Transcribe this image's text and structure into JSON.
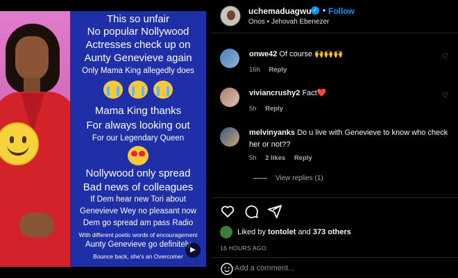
{
  "media": {
    "lines": [
      "This so unfair",
      "No popular Nollywood",
      "Actresses check up on",
      "Aunty Genevieve again",
      "Only Mama King allegedly does",
      "Mama King thanks",
      "For always looking out",
      "For our Legendary Queen",
      "Nollywood only spread",
      "Bad news of colleagues",
      "If Dem hear new Tori about",
      "Genevieve Wey no pleasant now",
      "Dem go spread am pass Radio",
      "With different poetic words of encouragement",
      "Aunty Genevieve go definitely",
      "Bounce back, she's an Overcomer"
    ],
    "background_color": "#1f2fa8"
  },
  "post": {
    "username": "uchemaduagwu",
    "follow_label": "Follow",
    "subtitle": "Onos • Jehovah Ebenezer",
    "accent_color": "#0095f6"
  },
  "comments": [
    {
      "user": "onwe42",
      "text": "Of course 🙌🙌🙌",
      "time": "16h",
      "reply": "Reply"
    },
    {
      "user": "viviancrushy2",
      "text": "Fact❤️",
      "time": "5h",
      "reply": "Reply"
    },
    {
      "user": "melvinyanks",
      "text": "Do u live with Genevieve to know who check her or not??",
      "time": "5h",
      "likes": "2 likes",
      "reply": "Reply"
    }
  ],
  "view_replies": "View replies (1)",
  "likes": {
    "prefix": "Liked by",
    "user": "tontolet",
    "conj": "and",
    "others": "373 others"
  },
  "time_ago": "16 HOURS AGO",
  "add_comment_placeholder": "Add a comment..."
}
